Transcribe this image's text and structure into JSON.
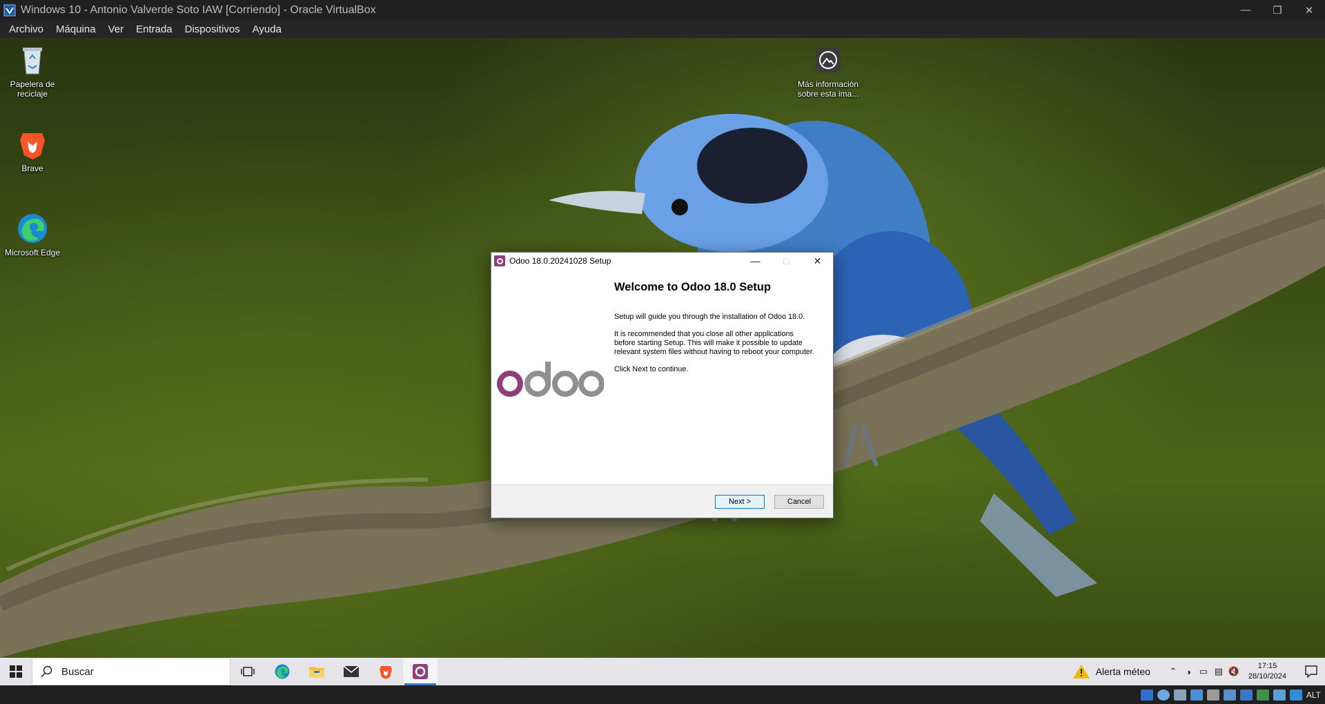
{
  "vbox": {
    "title": "Windows 10 - Antonio Valverde Soto IAW [Corriendo] - Oracle VirtualBox",
    "menu": [
      "Archivo",
      "Máquina",
      "Ver",
      "Entrada",
      "Dispositivos",
      "Ayuda"
    ],
    "host_key": "ALT"
  },
  "desktop": {
    "icons": [
      {
        "label": "Papelera de reciclaje",
        "icon": "recycle-bin-icon"
      },
      {
        "label": "Brave",
        "icon": "brave-icon"
      },
      {
        "label": "Microsoft Edge",
        "icon": "edge-icon"
      },
      {
        "label": "Más información sobre esta ima...",
        "icon": "info-camera-icon"
      }
    ]
  },
  "dialog": {
    "title": "Odoo 18.0.20241028 Setup",
    "heading": "Welcome to Odoo 18.0 Setup",
    "paragraphs": [
      "Setup will guide you through the installation of Odoo 18.0.",
      "It is recommended that you close all other applications before starting Setup. This will make it possible to update relevant system files without having to reboot your computer.",
      "Click Next to continue."
    ],
    "logo_text": "odoo",
    "next_label": "Next >",
    "cancel_label": "Cancel",
    "colors": {
      "odoo_purple": "#8f3f79",
      "odoo_gray": "#8f8f8f"
    }
  },
  "taskbar": {
    "search_placeholder": "Buscar",
    "apps": [
      "task-view-icon",
      "edge-icon",
      "file-explorer-icon",
      "mail-icon",
      "brave-icon",
      "odoo-setup-icon"
    ],
    "weather": "Alerta méteo",
    "time": "17:15",
    "date": "28/10/2024"
  }
}
